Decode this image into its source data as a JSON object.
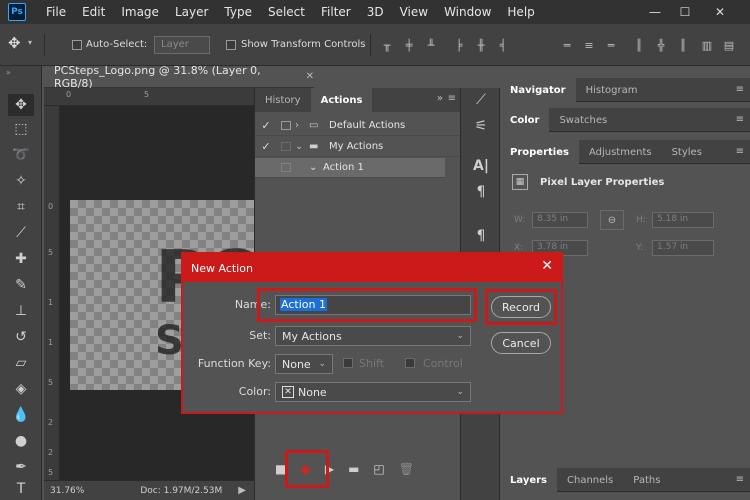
{
  "app": {
    "logo": "Ps",
    "menu": [
      "File",
      "Edit",
      "Image",
      "Layer",
      "Type",
      "Select",
      "Filter",
      "3D",
      "View",
      "Window",
      "Help"
    ],
    "window_controls": [
      "—",
      "☐",
      "✕"
    ]
  },
  "options_bar": {
    "auto_select_label": "Auto-Select:",
    "auto_select_value": "Layer",
    "show_transform_label": "Show Transform Controls"
  },
  "document": {
    "tab_title": "PCSteps_Logo.png @ 31.8% (Layer 0, RGB/8)",
    "tab_close": "✕",
    "zoom": "31.76%",
    "doc_info": "Doc: 1.97M/2.53M",
    "ruler_top": [
      "0",
      "5"
    ],
    "ruler_left": [
      "0",
      "5",
      "1",
      "1",
      "5",
      "2",
      "2",
      "5"
    ],
    "canvas_text_1": "PC",
    "canvas_text_2": "St"
  },
  "actions_panel": {
    "tabs": [
      "History",
      "Actions"
    ],
    "active_tab": "Actions",
    "rows": [
      {
        "check": "✓",
        "label": "Default Actions",
        "type": "set",
        "expanded": false
      },
      {
        "check": "✓",
        "label": "My Actions",
        "type": "set",
        "expanded": true
      },
      {
        "check": "",
        "label": "Action 1",
        "type": "action",
        "selected": true
      }
    ]
  },
  "right_panels": {
    "group1_tabs": [
      "Navigator",
      "Histogram"
    ],
    "group2_tabs": [
      "Color",
      "Swatches"
    ],
    "group3_tabs": [
      "Properties",
      "Adjustments",
      "Styles"
    ],
    "properties_title": "Pixel Layer Properties",
    "w_label": "W:",
    "w_value": "8.35 in",
    "h_label": "H:",
    "h_value": "5.18 in",
    "x_label": "X:",
    "x_value": "3.78 in",
    "y_label": "Y:",
    "y_value": "1.57 in",
    "bottom_tabs": [
      "Layers",
      "Channels",
      "Paths"
    ]
  },
  "dialog": {
    "title": "New Action",
    "close": "✕",
    "name_label": "Name:",
    "name_value": "Action 1",
    "set_label": "Set:",
    "set_value": "My Actions",
    "function_key_label": "Function Key:",
    "function_key_value": "None",
    "shift_label": "Shift",
    "control_label": "Control",
    "color_label": "Color:",
    "color_value": "None",
    "record_button": "Record",
    "cancel_button": "Cancel"
  },
  "colors": {
    "highlight": "#cc1a1a",
    "accent": "#31a8ff"
  }
}
